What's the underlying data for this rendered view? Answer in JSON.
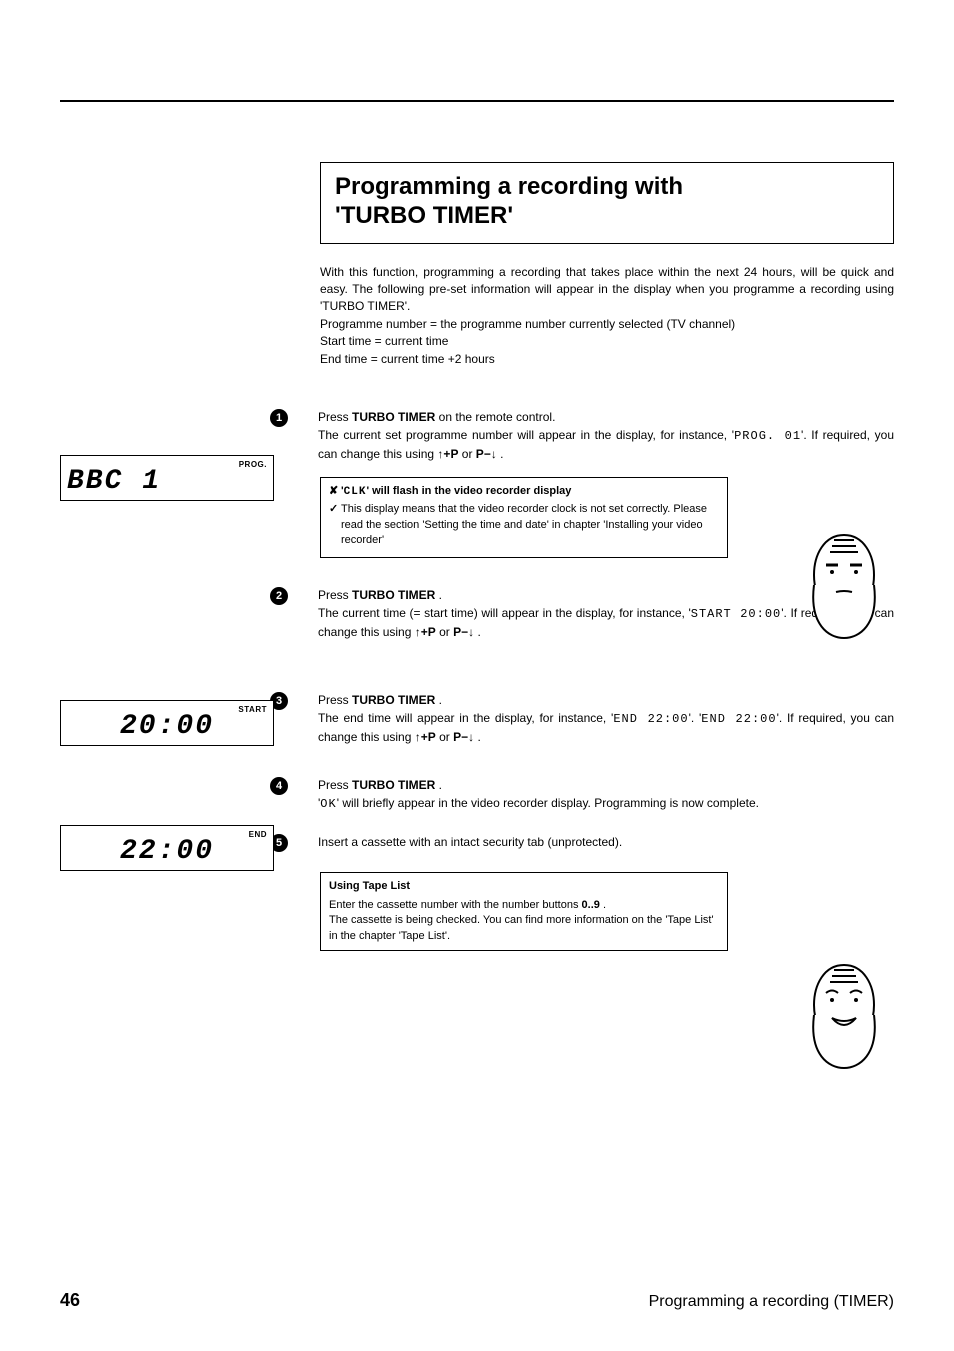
{
  "title_line1": "Programming a recording with",
  "title_line2": "'TURBO TIMER'",
  "intro": {
    "p1": "With this function, programming a recording that takes place within the next 24 hours, will be quick and easy. The following pre-set information will appear in the display when you programme a recording using 'TURBO TIMER'.",
    "p2": "Programme number = the programme number currently selected (TV channel)",
    "p3": "Start time = current time",
    "p4": "End time = current time +2 hours"
  },
  "displays": {
    "d1_label": "PROG.",
    "d1_value": "BBC 1",
    "d2_label": "START",
    "d2_value": "20:00",
    "d3_label": "END",
    "d3_value": "22:00"
  },
  "steps": {
    "s1a": "Press ",
    "s1b": "TURBO TIMER",
    "s1c": " on the remote control.",
    "s1d": "The current set programme number will appear in the display, for instance, '",
    "s1e": "PROG. 01",
    "s1f": "'. If required, you can change this using ",
    "s1g": "P",
    "s1h": " or ",
    "s1i": "P",
    "s1j": " .",
    "s2a": "Press ",
    "s2b": "TURBO TIMER",
    "s2c": " .",
    "s2d": "The current time (= start time) will appear in the display, for instance, '",
    "s2e": "START 20:00",
    "s2f": "'. If required, you can change this using ",
    "s2g": "P",
    "s2h": " or ",
    "s2i": "P",
    "s2j": " .",
    "s3a": "Press ",
    "s3b": "TURBO TIMER",
    "s3c": " .",
    "s3d": "The end time will appear in the display, for instance, '",
    "s3e": "END 22:00",
    "s3f": "'. '",
    "s3g": "END 22:00",
    "s3h": "'. If required, you can change this using ",
    "s3i": "P",
    "s3j": " or ",
    "s3k": "P",
    "s3l": " .",
    "s4a": "Press ",
    "s4b": "TURBO TIMER",
    "s4c": " .",
    "s4d": "'",
    "s4e": "OK",
    "s4f": "' will briefly appear in the video recorder display. Programming is now complete.",
    "s5": "Insert a cassette with an intact security tab (unprotected)."
  },
  "clk_note": {
    "title_pre": "'",
    "title_mid": "CLK",
    "title_post": "' will flash in the video recorder display",
    "body": "This display means that the video recorder clock is not set correctly. Please read the section 'Setting the time and date' in chapter 'Installing your video recorder'"
  },
  "tape": {
    "title": "Using Tape List",
    "l1a": "Enter the cassette number with the number buttons ",
    "l1b": "0..9",
    "l1c": " .",
    "l2": "The cassette is being checked. You can find more information on the 'Tape List' in the chapter 'Tape List'."
  },
  "footer": {
    "page": "46",
    "title": "Programming a recording (TIMER)"
  }
}
